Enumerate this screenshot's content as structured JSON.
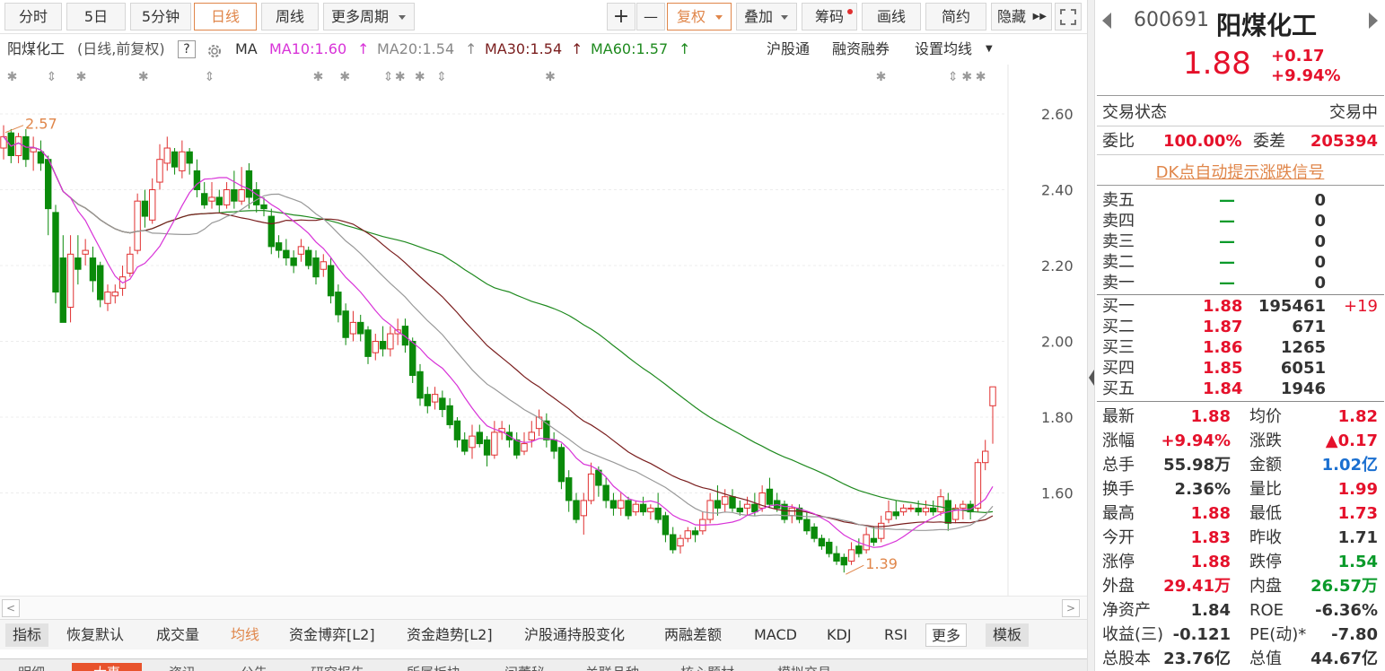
{
  "toolbar": {
    "tabs": [
      "分时",
      "5日",
      "5分钟",
      "日线",
      "周线",
      "更多周期"
    ],
    "plus": "+",
    "minus": "—",
    "fuquan": "复权",
    "diejia": "叠加",
    "chouma": "筹码",
    "huaxian": "画线",
    "jianyue": "简约",
    "yincang": "隐藏"
  },
  "info": {
    "name": "阳煤化工",
    "mode": "(日线,前复权)",
    "help": "?",
    "ma_label": "MA",
    "ma10": "MA10:1.60",
    "ma20": "MA20:1.54",
    "ma30": "MA30:1.54",
    "ma60": "MA60:1.57",
    "hgt": "沪股通",
    "rzrq": "融资融券",
    "setma": "设置均线"
  },
  "chart_data": {
    "type": "candlestick",
    "y_ticks": [
      "2.60",
      "2.40",
      "2.20",
      "2.00",
      "1.80",
      "1.60"
    ],
    "ylim": [
      1.35,
      2.67
    ],
    "annotations": {
      "high": "2.57",
      "low": "1.39"
    },
    "colors": {
      "up": "#e03030",
      "down": "#0a8a0a",
      "ma10": "#d833d8",
      "ma20": "#999999",
      "ma30": "#7a1e1e",
      "ma60": "#1f8a1f"
    },
    "candles": [
      [
        2.51,
        2.54,
        2.48,
        2.57
      ],
      [
        2.55,
        2.49,
        2.47,
        2.56
      ],
      [
        2.49,
        2.54,
        2.47,
        2.55
      ],
      [
        2.54,
        2.48,
        2.46,
        2.56
      ],
      [
        2.5,
        2.51,
        2.45,
        2.54
      ],
      [
        2.5,
        2.47,
        2.45,
        2.53
      ],
      [
        2.48,
        2.35,
        2.28,
        2.49
      ],
      [
        2.34,
        2.13,
        2.1,
        2.36
      ],
      [
        2.22,
        2.05,
        2.05,
        2.28
      ],
      [
        2.09,
        2.23,
        2.05,
        2.28
      ],
      [
        2.22,
        2.19,
        2.15,
        2.28
      ],
      [
        2.23,
        2.24,
        2.2,
        2.27
      ],
      [
        2.22,
        2.16,
        2.13,
        2.25
      ],
      [
        2.2,
        2.11,
        2.09,
        2.21
      ],
      [
        2.1,
        2.13,
        2.08,
        2.15
      ],
      [
        2.12,
        2.13,
        2.1,
        2.15
      ],
      [
        2.14,
        2.17,
        2.12,
        2.2
      ],
      [
        2.18,
        2.23,
        2.17,
        2.25
      ],
      [
        2.24,
        2.37,
        2.23,
        2.39
      ],
      [
        2.37,
        2.33,
        2.3,
        2.4
      ],
      [
        2.32,
        2.4,
        2.31,
        2.43
      ],
      [
        2.42,
        2.48,
        2.4,
        2.52
      ],
      [
        2.47,
        2.51,
        2.45,
        2.54
      ],
      [
        2.5,
        2.46,
        2.44,
        2.51
      ],
      [
        2.45,
        2.5,
        2.43,
        2.53
      ],
      [
        2.5,
        2.47,
        2.44,
        2.51
      ],
      [
        2.45,
        2.4,
        2.38,
        2.48
      ],
      [
        2.39,
        2.36,
        2.35,
        2.42
      ],
      [
        2.37,
        2.38,
        2.35,
        2.42
      ],
      [
        2.38,
        2.36,
        2.34,
        2.4
      ],
      [
        2.36,
        2.4,
        2.35,
        2.42
      ],
      [
        2.4,
        2.37,
        2.35,
        2.45
      ],
      [
        2.37,
        2.4,
        2.36,
        2.46
      ],
      [
        2.45,
        2.38,
        2.35,
        2.47
      ],
      [
        2.4,
        2.36,
        2.34,
        2.42
      ],
      [
        2.36,
        2.35,
        2.33,
        2.38
      ],
      [
        2.33,
        2.25,
        2.23,
        2.35
      ],
      [
        2.26,
        2.24,
        2.22,
        2.28
      ],
      [
        2.24,
        2.22,
        2.2,
        2.27
      ],
      [
        2.22,
        2.2,
        2.18,
        2.24
      ],
      [
        2.23,
        2.25,
        2.21,
        2.27
      ],
      [
        2.24,
        2.2,
        2.19,
        2.25
      ],
      [
        2.22,
        2.17,
        2.15,
        2.24
      ],
      [
        2.19,
        2.21,
        2.17,
        2.23
      ],
      [
        2.2,
        2.12,
        2.1,
        2.22
      ],
      [
        2.13,
        2.07,
        2.05,
        2.15
      ],
      [
        2.08,
        2.01,
        1.99,
        2.1
      ],
      [
        2.02,
        2.05,
        2.0,
        2.08
      ],
      [
        2.05,
        2.02,
        2.0,
        2.07
      ],
      [
        2.03,
        1.96,
        1.94,
        2.04
      ],
      [
        1.97,
        2.0,
        1.95,
        2.02
      ],
      [
        2.0,
        1.98,
        1.96,
        2.04
      ],
      [
        1.98,
        2.02,
        1.96,
        2.04
      ],
      [
        2.02,
        2.03,
        1.99,
        2.06
      ],
      [
        2.04,
        1.99,
        1.97,
        2.06
      ],
      [
        2.0,
        1.91,
        1.89,
        2.01
      ],
      [
        1.92,
        1.85,
        1.83,
        1.94
      ],
      [
        1.86,
        1.83,
        1.81,
        1.88
      ],
      [
        1.84,
        1.86,
        1.82,
        1.88
      ],
      [
        1.85,
        1.82,
        1.8,
        1.87
      ],
      [
        1.83,
        1.78,
        1.77,
        1.85
      ],
      [
        1.79,
        1.74,
        1.72,
        1.8
      ],
      [
        1.74,
        1.71,
        1.7,
        1.76
      ],
      [
        1.72,
        1.75,
        1.69,
        1.78
      ],
      [
        1.76,
        1.73,
        1.72,
        1.78
      ],
      [
        1.74,
        1.7,
        1.67,
        1.75
      ],
      [
        1.7,
        1.76,
        1.69,
        1.79
      ],
      [
        1.76,
        1.77,
        1.74,
        1.79
      ],
      [
        1.76,
        1.74,
        1.72,
        1.78
      ],
      [
        1.74,
        1.7,
        1.69,
        1.76
      ],
      [
        1.71,
        1.73,
        1.7,
        1.76
      ],
      [
        1.74,
        1.76,
        1.72,
        1.79
      ],
      [
        1.77,
        1.8,
        1.75,
        1.82
      ],
      [
        1.79,
        1.74,
        1.72,
        1.81
      ],
      [
        1.74,
        1.71,
        1.69,
        1.76
      ],
      [
        1.72,
        1.63,
        1.61,
        1.73
      ],
      [
        1.64,
        1.58,
        1.55,
        1.66
      ],
      [
        1.58,
        1.53,
        1.52,
        1.6
      ],
      [
        1.54,
        1.58,
        1.49,
        1.6
      ],
      [
        1.58,
        1.65,
        1.57,
        1.68
      ],
      [
        1.66,
        1.62,
        1.59,
        1.67
      ],
      [
        1.62,
        1.58,
        1.56,
        1.64
      ],
      [
        1.58,
        1.56,
        1.54,
        1.6
      ],
      [
        1.56,
        1.58,
        1.54,
        1.6
      ],
      [
        1.58,
        1.54,
        1.53,
        1.59
      ],
      [
        1.55,
        1.57,
        1.54,
        1.58
      ],
      [
        1.57,
        1.55,
        1.54,
        1.59
      ],
      [
        1.55,
        1.56,
        1.53,
        1.57
      ],
      [
        1.56,
        1.53,
        1.52,
        1.6
      ],
      [
        1.54,
        1.49,
        1.47,
        1.55
      ],
      [
        1.49,
        1.45,
        1.44,
        1.51
      ],
      [
        1.46,
        1.48,
        1.44,
        1.49
      ],
      [
        1.48,
        1.5,
        1.47,
        1.51
      ],
      [
        1.5,
        1.49,
        1.47,
        1.51
      ],
      [
        1.5,
        1.53,
        1.49,
        1.55
      ],
      [
        1.53,
        1.58,
        1.52,
        1.6
      ],
      [
        1.58,
        1.56,
        1.54,
        1.62
      ],
      [
        1.57,
        1.59,
        1.55,
        1.61
      ],
      [
        1.59,
        1.56,
        1.55,
        1.61
      ],
      [
        1.56,
        1.55,
        1.54,
        1.58
      ],
      [
        1.56,
        1.57,
        1.54,
        1.59
      ],
      [
        1.57,
        1.55,
        1.54,
        1.6
      ],
      [
        1.56,
        1.6,
        1.55,
        1.62
      ],
      [
        1.61,
        1.57,
        1.56,
        1.64
      ],
      [
        1.58,
        1.56,
        1.55,
        1.6
      ],
      [
        1.57,
        1.53,
        1.52,
        1.58
      ],
      [
        1.54,
        1.56,
        1.52,
        1.57
      ],
      [
        1.56,
        1.53,
        1.52,
        1.57
      ],
      [
        1.53,
        1.5,
        1.49,
        1.55
      ],
      [
        1.51,
        1.48,
        1.47,
        1.52
      ],
      [
        1.48,
        1.46,
        1.45,
        1.49
      ],
      [
        1.47,
        1.44,
        1.43,
        1.48
      ],
      [
        1.44,
        1.42,
        1.41,
        1.46
      ],
      [
        1.43,
        1.41,
        1.39,
        1.44
      ],
      [
        1.42,
        1.45,
        1.41,
        1.47
      ],
      [
        1.46,
        1.44,
        1.43,
        1.48
      ],
      [
        1.45,
        1.49,
        1.44,
        1.51
      ],
      [
        1.48,
        1.47,
        1.46,
        1.51
      ],
      [
        1.48,
        1.52,
        1.47,
        1.54
      ],
      [
        1.53,
        1.55,
        1.52,
        1.58
      ],
      [
        1.55,
        1.54,
        1.53,
        1.58
      ],
      [
        1.55,
        1.56,
        1.54,
        1.57
      ],
      [
        1.56,
        1.56,
        1.55,
        1.57
      ],
      [
        1.56,
        1.55,
        1.54,
        1.58
      ],
      [
        1.55,
        1.56,
        1.54,
        1.58
      ],
      [
        1.56,
        1.55,
        1.54,
        1.58
      ],
      [
        1.55,
        1.59,
        1.54,
        1.61
      ],
      [
        1.58,
        1.52,
        1.5,
        1.6
      ],
      [
        1.53,
        1.56,
        1.52,
        1.57
      ],
      [
        1.56,
        1.57,
        1.53,
        1.58
      ],
      [
        1.57,
        1.55,
        1.53,
        1.58
      ],
      [
        1.56,
        1.68,
        1.55,
        1.69
      ],
      [
        1.68,
        1.71,
        1.66,
        1.74
      ],
      [
        1.83,
        1.88,
        1.73,
        1.88
      ]
    ]
  },
  "indicators": [
    "指标",
    "恢复默认",
    "成交量",
    "均线",
    "资金博弈[L2]",
    "资金趋势[L2]",
    "沪股通持股变化",
    "两融差额",
    "MACD",
    "KDJ",
    "RSI",
    "更多",
    "模板"
  ],
  "bottom_tabs": [
    "明细",
    "大事",
    "资讯",
    "公告",
    "研究报告",
    "所属板块",
    "问董秘",
    "关联品种",
    "核心题材",
    "模拟交易"
  ],
  "quote": {
    "code": "600691",
    "name": "阳煤化工",
    "price": "1.88",
    "change": "+0.17",
    "pct": "+9.94%",
    "status_label": "交易状态",
    "status_value": "交易中",
    "weibi_label": "委比",
    "weibi_value": "100.00%",
    "weicha_label": "委差",
    "weicha_value": "205394",
    "dk_link": "DK点自动提示涨跌信号",
    "asks": [
      {
        "label": "卖五",
        "price": "—",
        "vol": "0"
      },
      {
        "label": "卖四",
        "price": "—",
        "vol": "0"
      },
      {
        "label": "卖三",
        "price": "—",
        "vol": "0"
      },
      {
        "label": "卖二",
        "price": "—",
        "vol": "0"
      },
      {
        "label": "卖一",
        "price": "—",
        "vol": "0"
      }
    ],
    "bids": [
      {
        "label": "买一",
        "price": "1.88",
        "vol": "195461",
        "delta": "+19"
      },
      {
        "label": "买二",
        "price": "1.87",
        "vol": "671",
        "delta": ""
      },
      {
        "label": "买三",
        "price": "1.86",
        "vol": "1265",
        "delta": ""
      },
      {
        "label": "买四",
        "price": "1.85",
        "vol": "6051",
        "delta": ""
      },
      {
        "label": "买五",
        "price": "1.84",
        "vol": "1946",
        "delta": ""
      }
    ],
    "stats": [
      {
        "l1": "最新",
        "v1": "1.88",
        "c1": "red",
        "l2": "均价",
        "v2": "1.82",
        "c2": "red"
      },
      {
        "l1": "涨幅",
        "v1": "+9.94%",
        "c1": "red",
        "l2": "涨跌",
        "v2": "▲0.17",
        "c2": "red"
      },
      {
        "l1": "总手",
        "v1": "55.98万",
        "c1": "",
        "l2": "金额",
        "v2": "1.02亿",
        "c2": "blue"
      },
      {
        "l1": "换手",
        "v1": "2.36%",
        "c1": "",
        "l2": "量比",
        "v2": "1.99",
        "c2": "red"
      },
      {
        "l1": "最高",
        "v1": "1.88",
        "c1": "red",
        "l2": "最低",
        "v2": "1.73",
        "c2": "red"
      },
      {
        "l1": "今开",
        "v1": "1.83",
        "c1": "red",
        "l2": "昨收",
        "v2": "1.71",
        "c2": ""
      },
      {
        "l1": "涨停",
        "v1": "1.88",
        "c1": "red",
        "l2": "跌停",
        "v2": "1.54",
        "c2": "green"
      },
      {
        "l1": "外盘",
        "v1": "29.41万",
        "c1": "red",
        "l2": "内盘",
        "v2": "26.57万",
        "c2": "green"
      },
      {
        "l1": "净资产",
        "v1": "1.84",
        "c1": "",
        "l2": "ROE",
        "v2": "-6.36%",
        "c2": ""
      },
      {
        "l1": "收益(三)",
        "v1": "-0.121",
        "c1": "",
        "l2": "PE(动)*",
        "v2": "-7.80",
        "c2": ""
      },
      {
        "l1": "总股本",
        "v1": "23.76亿",
        "c1": "",
        "l2": "总值",
        "v2": "44.67亿",
        "c2": ""
      }
    ]
  }
}
